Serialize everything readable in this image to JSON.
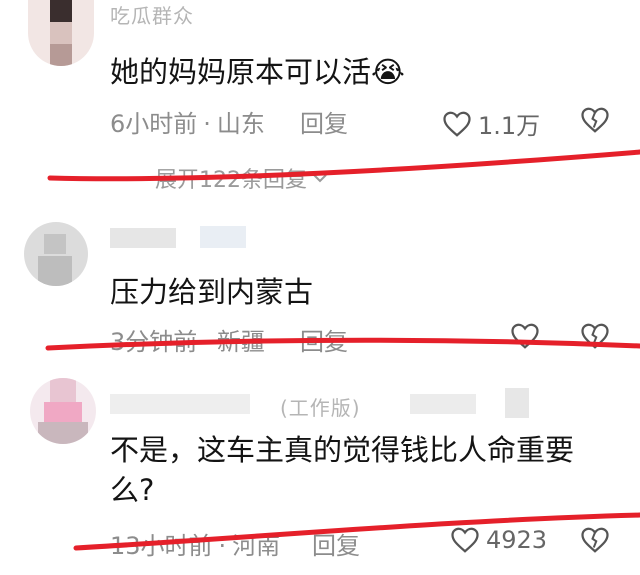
{
  "comments": [
    {
      "username": "吃瓜群众",
      "content": "她的妈妈原本可以活😭",
      "time": "6小时前",
      "location": "山东",
      "reply_label": "回复",
      "likes": "1.1万",
      "expand_label": "展开122条回复"
    },
    {
      "username": "",
      "content": "压力给到内蒙古",
      "time": "3分钟前",
      "location": "新疆",
      "reply_label": "回复",
      "likes": ""
    },
    {
      "username": "",
      "badge": "(工作版)",
      "content_line1": "不是，这车主真的觉得钱比人命重要",
      "content_line2": "么?",
      "time": "13小时前",
      "location": "河南",
      "reply_label": "回复",
      "likes": "4923"
    }
  ],
  "annotation_color": "#e5202a"
}
